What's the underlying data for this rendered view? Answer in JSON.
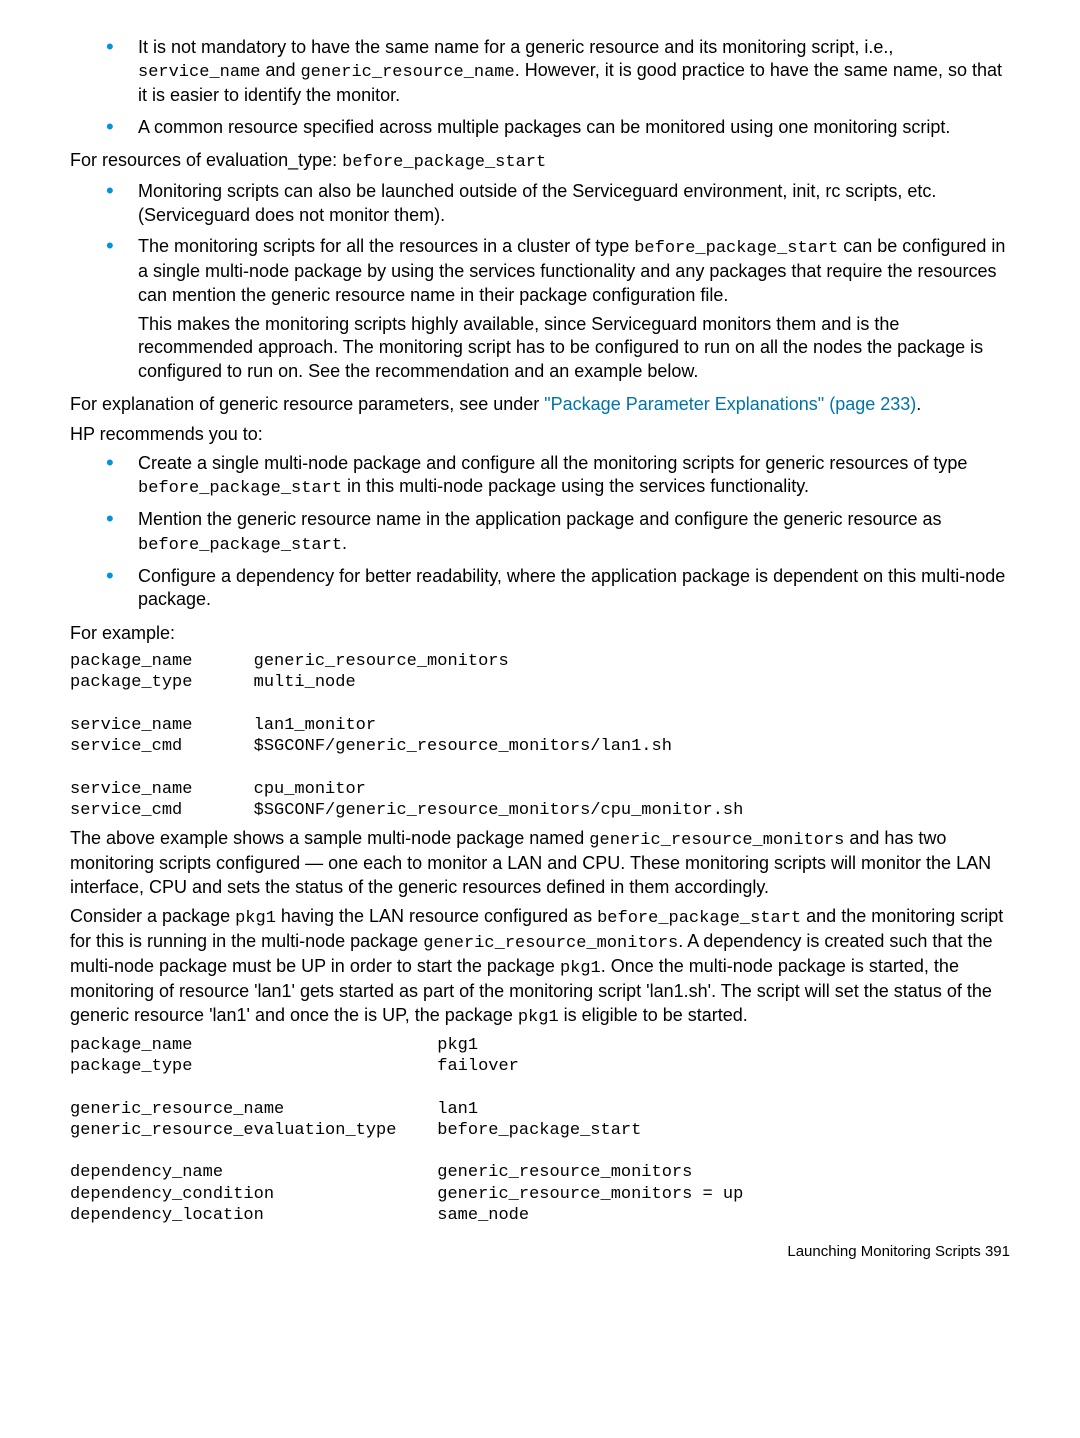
{
  "bullets1": {
    "item1a": "It is not mandatory to have the same name for a generic resource and its monitoring script, i.e., ",
    "item1code1": "service_name",
    "item1mid": " and ",
    "item1code2": "generic_resource_name",
    "item1b": ". However, it is good practice to have the same name, so that it is easier to identify the monitor.",
    "item2": "A common resource specified across multiple packages can be monitored using one monitoring script."
  },
  "para1a": "For resources of evaluation_type: ",
  "para1code": "before_package_start",
  "bullets2": {
    "item1": "Monitoring scripts can also be launched outside of the Serviceguard environment, init, rc scripts, etc. (Serviceguard does not monitor them).",
    "item2a": "The monitoring scripts for all the resources in a cluster of type ",
    "item2code": "before_package_start",
    "item2b": " can be configured in a single multi-node package by using the services functionality and any packages that require the resources can mention the generic resource name in their package configuration file.",
    "item2sub": "This makes the monitoring scripts highly available, since Serviceguard monitors them and is the recommended approach. The monitoring script has to be configured to run on all the nodes the package is configured to run on. See the recommendation and an example below."
  },
  "para2a": "For explanation of generic resource parameters, see under ",
  "para2link": "\"Package Parameter Explanations\" (page 233)",
  "para2b": ".",
  "para3": "HP recommends you to:",
  "bullets3": {
    "item1a": "Create a single multi-node package and configure all the monitoring scripts for generic resources of type ",
    "item1code": "before_package_start",
    "item1b": " in this multi-node package using the services functionality.",
    "item2a": "Mention the generic resource name in the application package and configure the generic resource as ",
    "item2code": "before_package_start",
    "item2b": ".",
    "item3": "Configure a dependency for better readability, where the application package is dependent on this multi-node package."
  },
  "para4": "For example:",
  "codeblock1": "package_name      generic_resource_monitors\npackage_type      multi_node\n\nservice_name      lan1_monitor\nservice_cmd       $SGCONF/generic_resource_monitors/lan1.sh\n\nservice_name      cpu_monitor\nservice_cmd       $SGCONF/generic_resource_monitors/cpu_monitor.sh",
  "para5a": "The above example shows a sample multi-node package named ",
  "para5code": "generic_resource_monitors",
  "para5b": " and has two monitoring scripts configured — one each to monitor a LAN and CPU. These monitoring scripts will monitor the LAN interface, CPU and sets the status of the generic resources defined in them accordingly.",
  "para6a": "Consider a package ",
  "para6code1": "pkg1",
  "para6b": " having the LAN resource configured as ",
  "para6code2": "before_package_start",
  "para6c": " and the monitoring script for this is running in the multi-node package ",
  "para6code3": "generic_resource_monitors",
  "para6d": ". A dependency is created such that the multi-node package must be UP in order to start the package ",
  "para6code4": "pkg1",
  "para6e": ". Once the multi-node package is started, the monitoring of resource 'lan1' gets started as part of the monitoring script 'lan1.sh'. The script will set the status of the generic resource 'lan1' and once the is UP, the package ",
  "para6code5": "pkg1",
  "para6f": " is eligible to be started.",
  "codeblock2": "package_name                        pkg1\npackage_type                        failover\n\ngeneric_resource_name               lan1\ngeneric_resource_evaluation_type    before_package_start\n\ndependency_name                     generic_resource_monitors\ndependency_condition                generic_resource_monitors = up\ndependency_location                 same_node",
  "footer": "Launching Monitoring Scripts    391"
}
